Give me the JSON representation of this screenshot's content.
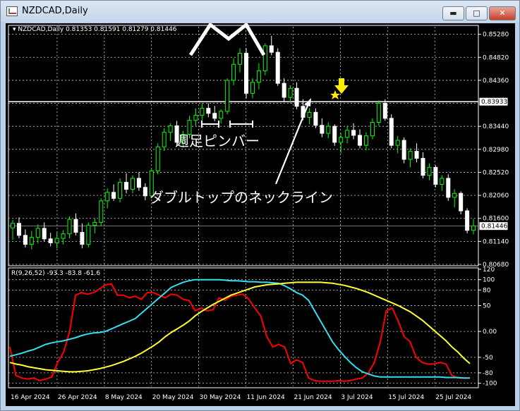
{
  "window": {
    "title": "NZDCAD,Daily",
    "min_icon": "minimize-icon",
    "max_icon": "maximize-icon",
    "close_icon": "close-icon"
  },
  "colors": {
    "background": "#000000",
    "bull": "#00ff00",
    "bear": "#ffffff",
    "red_line": "#ff0000",
    "cyan_line": "#33e0f0",
    "yellow_line": "#ffff33",
    "marker": "#ffee00"
  },
  "chart_data": [
    {
      "type": "candlestick",
      "title": "NZDCAD,Daily 0.81353 0.81591 0.81279 0.81446",
      "ylim": [
        0.8068,
        0.8543
      ],
      "yticks": [
        "0.85280",
        "0.84820",
        "0.84360",
        "0.83900",
        "0.83440",
        "0.82980",
        "0.82520",
        "0.82060",
        "0.81600",
        "0.81140",
        "0.80680"
      ],
      "price_labels": [
        "0.83933",
        "0.81446"
      ],
      "current_price": 0.81446,
      "neckline_price": 0.83933,
      "annotations": [
        "週足ピンバー",
        "ダブルトップのネックライン"
      ],
      "grid": true,
      "candles": [
        [
          0.8141,
          0.8157,
          0.8117,
          0.815
        ],
        [
          0.815,
          0.8162,
          0.812,
          0.8126
        ],
        [
          0.8126,
          0.8138,
          0.8102,
          0.8108
        ],
        [
          0.8108,
          0.8135,
          0.8098,
          0.8122
        ],
        [
          0.8122,
          0.8148,
          0.811,
          0.814
        ],
        [
          0.814,
          0.8152,
          0.8114,
          0.8119
        ],
        [
          0.8119,
          0.8131,
          0.8104,
          0.8111
        ],
        [
          0.8111,
          0.8132,
          0.81,
          0.812
        ],
        [
          0.812,
          0.8136,
          0.8108,
          0.8129
        ],
        [
          0.8129,
          0.8164,
          0.812,
          0.8158
        ],
        [
          0.8158,
          0.817,
          0.8126,
          0.8132
        ],
        [
          0.8132,
          0.815,
          0.81,
          0.8108
        ],
        [
          0.8108,
          0.8152,
          0.8102,
          0.8146
        ],
        [
          0.8146,
          0.816,
          0.813,
          0.8152
        ],
        [
          0.8152,
          0.82,
          0.8145,
          0.8195
        ],
        [
          0.8195,
          0.822,
          0.818,
          0.8212
        ],
        [
          0.8212,
          0.8228,
          0.8195,
          0.82
        ],
        [
          0.82,
          0.824,
          0.8192,
          0.8232
        ],
        [
          0.8232,
          0.825,
          0.821,
          0.8218
        ],
        [
          0.8218,
          0.8246,
          0.821,
          0.824
        ],
        [
          0.824,
          0.8252,
          0.8215,
          0.8222
        ],
        [
          0.8222,
          0.823,
          0.8196,
          0.8205
        ],
        [
          0.8205,
          0.826,
          0.82,
          0.8255
        ],
        [
          0.8255,
          0.831,
          0.8248,
          0.8303
        ],
        [
          0.8303,
          0.834,
          0.8295,
          0.8332
        ],
        [
          0.8332,
          0.835,
          0.8315,
          0.8345
        ],
        [
          0.8345,
          0.8355,
          0.8305,
          0.8312
        ],
        [
          0.8312,
          0.8335,
          0.8302,
          0.8328
        ],
        [
          0.8328,
          0.8365,
          0.832,
          0.8356
        ],
        [
          0.8356,
          0.838,
          0.8345,
          0.8366
        ],
        [
          0.8366,
          0.839,
          0.8356,
          0.838
        ],
        [
          0.838,
          0.839,
          0.8362,
          0.837
        ],
        [
          0.837,
          0.8385,
          0.8354,
          0.836
        ],
        [
          0.836,
          0.8378,
          0.835,
          0.8374
        ],
        [
          0.8374,
          0.844,
          0.8368,
          0.8436
        ],
        [
          0.8436,
          0.848,
          0.8426,
          0.8468
        ],
        [
          0.8468,
          0.85,
          0.8452,
          0.849
        ],
        [
          0.849,
          0.85,
          0.84,
          0.841
        ],
        [
          0.841,
          0.844,
          0.84,
          0.8432
        ],
        [
          0.8432,
          0.847,
          0.8418,
          0.8455
        ],
        [
          0.8455,
          0.851,
          0.8446,
          0.8505
        ],
        [
          0.8505,
          0.8525,
          0.8486,
          0.8492
        ],
        [
          0.8492,
          0.85,
          0.8425,
          0.843
        ],
        [
          0.843,
          0.844,
          0.8394,
          0.8402
        ],
        [
          0.8402,
          0.8426,
          0.839,
          0.842
        ],
        [
          0.842,
          0.8432,
          0.8378,
          0.8384
        ],
        [
          0.8384,
          0.8398,
          0.8356,
          0.8362
        ],
        [
          0.8362,
          0.838,
          0.8348,
          0.8372
        ],
        [
          0.8372,
          0.838,
          0.834,
          0.8346
        ],
        [
          0.8346,
          0.836,
          0.8322,
          0.833
        ],
        [
          0.833,
          0.8352,
          0.832,
          0.8344
        ],
        [
          0.8344,
          0.8348,
          0.8305,
          0.8312
        ],
        [
          0.8312,
          0.833,
          0.829,
          0.8322
        ],
        [
          0.8322,
          0.8345,
          0.831,
          0.8336
        ],
        [
          0.8336,
          0.835,
          0.8318,
          0.8326
        ],
        [
          0.8326,
          0.8338,
          0.83,
          0.8306
        ],
        [
          0.8306,
          0.8332,
          0.8296,
          0.8325
        ],
        [
          0.8325,
          0.836,
          0.8318,
          0.8352
        ],
        [
          0.8352,
          0.8396,
          0.8345,
          0.839
        ],
        [
          0.839,
          0.8398,
          0.8355,
          0.836
        ],
        [
          0.836,
          0.8368,
          0.83,
          0.8306
        ],
        [
          0.8306,
          0.8325,
          0.829,
          0.8316
        ],
        [
          0.8316,
          0.8322,
          0.827,
          0.8278
        ],
        [
          0.8278,
          0.83,
          0.8262,
          0.8294
        ],
        [
          0.8294,
          0.831,
          0.8272,
          0.828
        ],
        [
          0.828,
          0.8292,
          0.824,
          0.8246
        ],
        [
          0.8246,
          0.827,
          0.8236,
          0.8262
        ],
        [
          0.8262,
          0.8266,
          0.8222,
          0.8228
        ],
        [
          0.8228,
          0.8246,
          0.8215,
          0.824
        ],
        [
          0.824,
          0.8248,
          0.8195,
          0.8202
        ],
        [
          0.8202,
          0.8218,
          0.8182,
          0.821
        ],
        [
          0.821,
          0.8214,
          0.8168,
          0.8175
        ],
        [
          0.8175,
          0.818,
          0.813,
          0.8136
        ],
        [
          0.8136,
          0.8159,
          0.8128,
          0.8145
        ]
      ]
    },
    {
      "type": "line",
      "title": "R(9,26,52) -93.3 -83.8 -61.6",
      "ylim": [
        -106,
        120
      ],
      "yticks": [
        "120",
        "100",
        "80",
        "50",
        "0.00",
        "-50",
        "-80",
        "-100"
      ],
      "xlabels": [
        "16 Apr 2024",
        "26 Apr 2024",
        "8 May 2024",
        "20 May 2024",
        "30 May 2024",
        "11 Jun 2024",
        "21 Jun 2024",
        "3 Jul 2024",
        "15 Jul 2024",
        "25 Jul 2024"
      ],
      "series": [
        {
          "values": [
            -30,
            -85,
            -90,
            -92,
            -90,
            -95,
            -92,
            -88,
            -60,
            -40,
            0,
            70,
            75,
            72,
            75,
            82,
            90,
            92,
            70,
            70,
            65,
            68,
            62,
            75,
            75,
            70,
            65,
            72,
            70,
            62,
            60,
            40,
            45,
            40,
            42,
            65,
            60,
            68,
            70,
            72,
            62,
            45,
            30,
            -10,
            -30,
            -25,
            -30,
            -62,
            -55,
            -60,
            -90,
            -95,
            -96,
            -96,
            -96,
            -95,
            -96,
            -95,
            -92,
            -90,
            -80,
            -60,
            -20,
            40,
            45,
            20,
            -10,
            -20,
            -50,
            -60,
            -63,
            -63,
            -60,
            -63,
            -85,
            -90,
            -90,
            -90
          ]
        },
        {
          "values": [
            -48,
            -45,
            -42,
            -38,
            -35,
            -30,
            -25,
            -22,
            -20,
            -18,
            -15,
            -12,
            -8,
            -5,
            -3,
            -2,
            0,
            5,
            10,
            15,
            20,
            25,
            35,
            45,
            55,
            65,
            75,
            85,
            90,
            95,
            98,
            100,
            100,
            100,
            100,
            100,
            99,
            98,
            98,
            97,
            96,
            96,
            95,
            95,
            94,
            93,
            88,
            82,
            75,
            70,
            60,
            40,
            20,
            0,
            -20,
            -35,
            -48,
            -60,
            -70,
            -78,
            -82,
            -86,
            -88,
            -88,
            -88,
            -88,
            -88,
            -88,
            -88,
            -88,
            -88,
            -88,
            -88,
            -89,
            -89,
            -89,
            -90,
            -90
          ]
        },
        {
          "values": [
            -60,
            -63,
            -65,
            -68,
            -70,
            -72,
            -74,
            -75,
            -76,
            -77,
            -78,
            -78,
            -77,
            -76,
            -74,
            -72,
            -69,
            -66,
            -62,
            -58,
            -53,
            -48,
            -42,
            -35,
            -28,
            -20,
            -10,
            -2,
            5,
            12,
            20,
            30,
            38,
            45,
            52,
            58,
            64,
            70,
            74,
            78,
            82,
            86,
            88,
            90,
            91,
            92,
            93,
            94,
            95,
            95,
            95,
            95,
            95,
            94,
            93,
            91,
            89,
            86,
            83,
            79,
            75,
            70,
            65,
            60,
            55,
            50,
            44,
            38,
            30,
            22,
            12,
            2,
            -8,
            -18,
            -30,
            -40,
            -52,
            -62
          ]
        }
      ]
    }
  ]
}
